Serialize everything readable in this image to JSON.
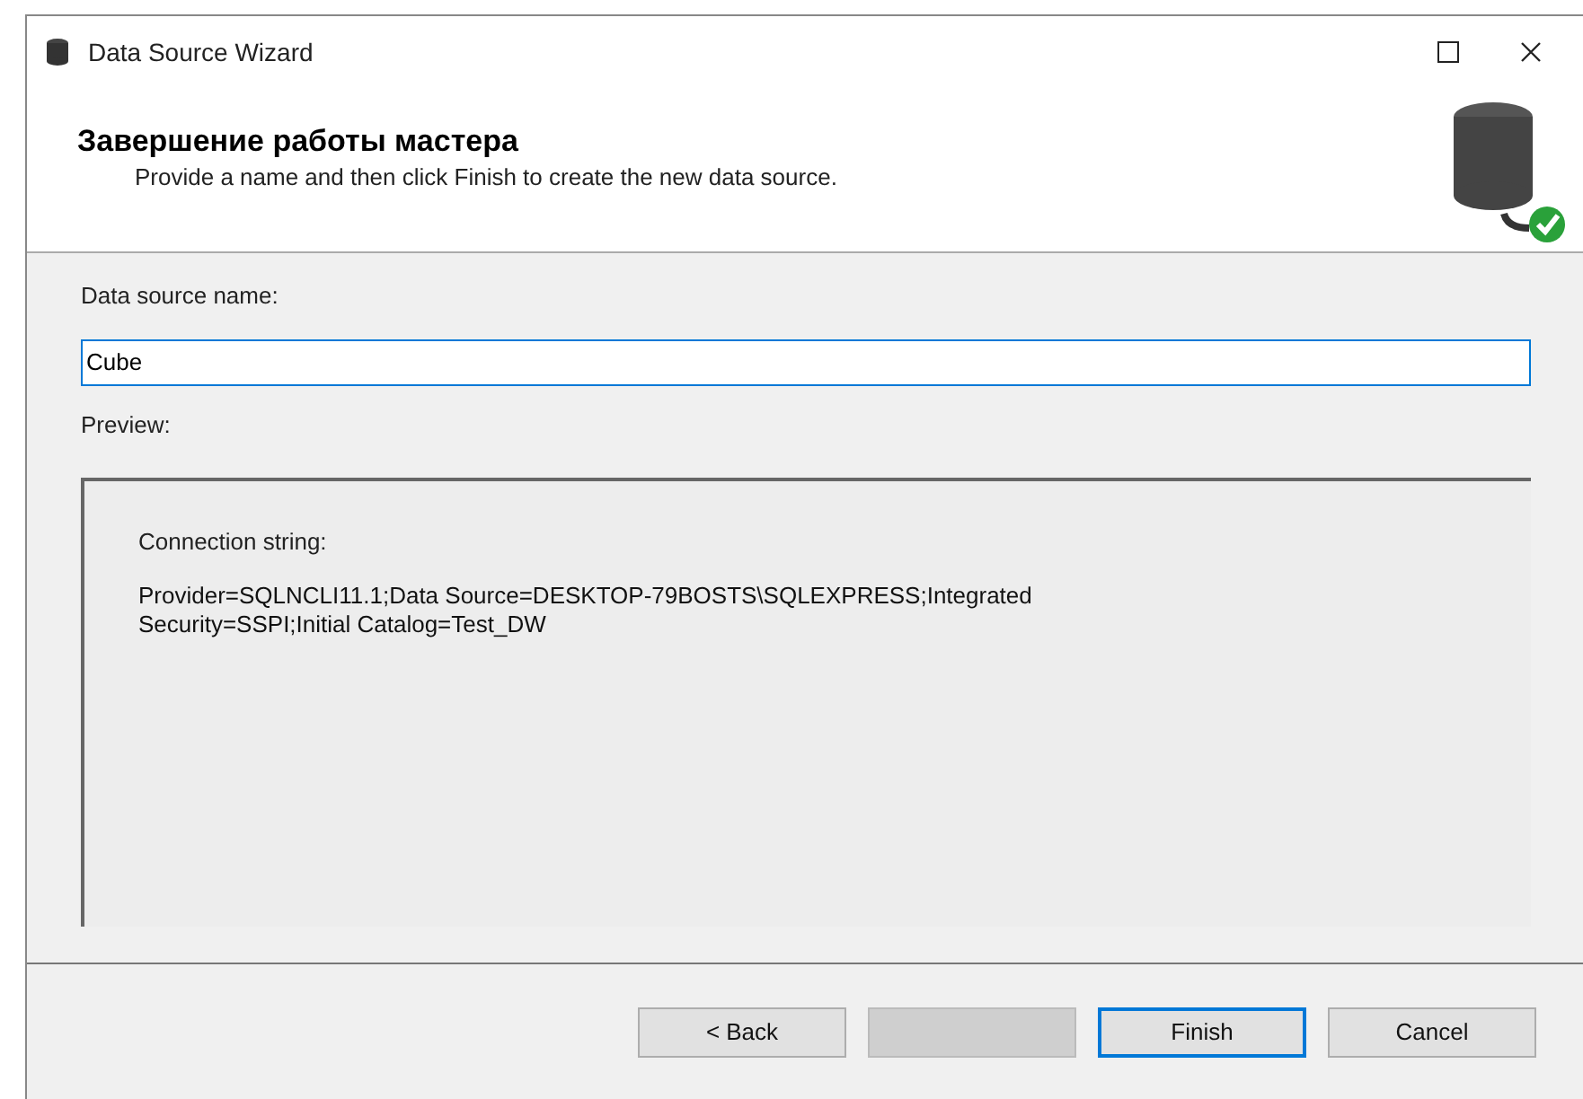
{
  "window": {
    "title": "Data Source Wizard"
  },
  "header": {
    "title": "Завершение работы мастера",
    "subtitle": "Provide a name and then click Finish to create the new data source."
  },
  "name_field": {
    "label": "Data source name:",
    "value": "Cube"
  },
  "preview": {
    "label": "Preview:",
    "heading": "Connection string:",
    "text": "Provider=SQLNCLI11.1;Data Source=DESKTOP-79BOSTS\\SQLEXPRESS;Integrated Security=SSPI;Initial Catalog=Test_DW"
  },
  "buttons": [
    {
      "label": "< Back",
      "disabled": false,
      "default": false
    },
    {
      "disabled": true,
      "default": false
    },
    {
      "label": "Finish",
      "disabled": false,
      "default": true
    },
    {
      "label": "Cancel",
      "disabled": false,
      "default": false
    }
  ]
}
